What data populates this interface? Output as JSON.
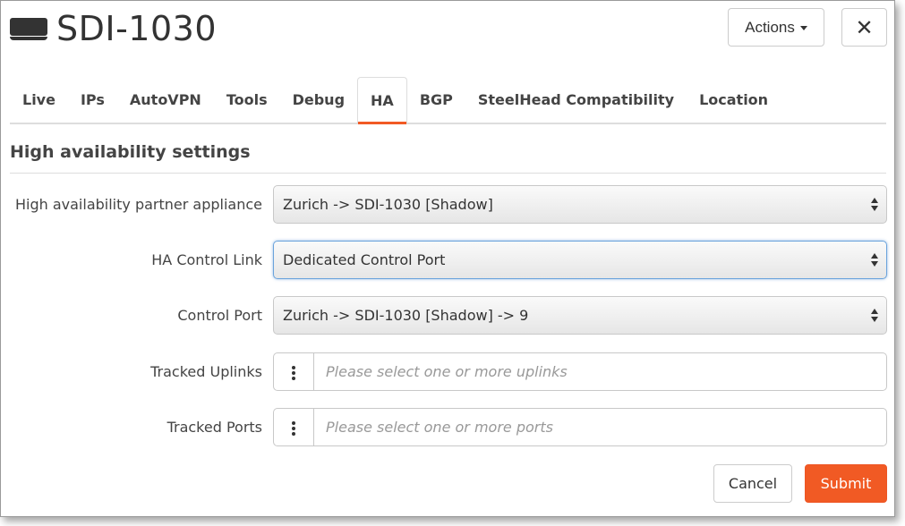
{
  "header": {
    "title": "SDI-1030",
    "device_icon": "appliance-icon",
    "actions_label": "Actions",
    "close_icon": "close-icon",
    "close_glyph": "✕"
  },
  "tabs": [
    {
      "label": "Live",
      "active": false
    },
    {
      "label": "IPs",
      "active": false
    },
    {
      "label": "AutoVPN",
      "active": false
    },
    {
      "label": "Tools",
      "active": false
    },
    {
      "label": "Debug",
      "active": false
    },
    {
      "label": "HA",
      "active": true
    },
    {
      "label": "BGP",
      "active": false
    },
    {
      "label": "SteelHead Compatibility",
      "active": false
    },
    {
      "label": "Location",
      "active": false
    }
  ],
  "section": {
    "title": "High availability settings"
  },
  "form": {
    "partner": {
      "label": "High availability partner appliance",
      "value": "Zurich -> SDI-1030 [Shadow]"
    },
    "control_link": {
      "label": "HA Control Link",
      "value": "Dedicated Control Port"
    },
    "control_port": {
      "label": "Control Port",
      "value": "Zurich -> SDI-1030 [Shadow] -> 9"
    },
    "tracked_uplinks": {
      "label": "Tracked Uplinks",
      "placeholder": "Please select one or more uplinks"
    },
    "tracked_ports": {
      "label": "Tracked Ports",
      "placeholder": "Please select one or more ports"
    }
  },
  "footer": {
    "cancel_label": "Cancel",
    "submit_label": "Submit"
  },
  "colors": {
    "accent": "#f15a24",
    "focus": "#6aa3dc"
  }
}
